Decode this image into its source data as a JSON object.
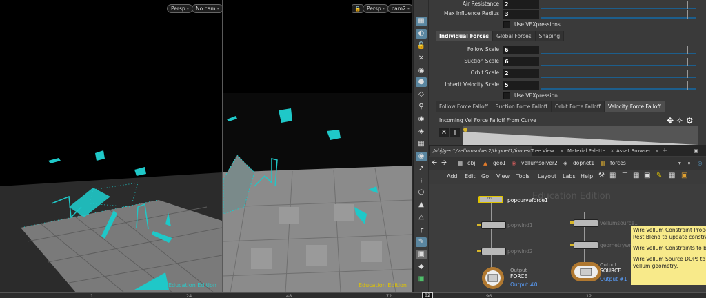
{
  "viewports": {
    "left": {
      "persp": "Persp -",
      "cam": "No cam -",
      "edu": "Education Edition"
    },
    "right": {
      "persp": "Persp -",
      "cam": "cam2 -",
      "edu": "Education Edition"
    }
  },
  "params": {
    "air_resistance": {
      "label": "Air Resistance",
      "value": "2"
    },
    "max_influence_radius": {
      "label": "Max Influence Radius",
      "value": "3"
    },
    "use_vex_1": "Use VEXpressions",
    "tabs": [
      "Individual Forces",
      "Global Forces",
      "Shaping"
    ],
    "follow_scale": {
      "label": "Follow Scale",
      "value": "6"
    },
    "suction_scale": {
      "label": "Suction Scale",
      "value": "6"
    },
    "orbit_scale": {
      "label": "Orbit Scale",
      "value": "2"
    },
    "inherit_velocity_scale": {
      "label": "Inherit Velocity Scale",
      "value": "5"
    },
    "use_vex_2": "Use VEXpression",
    "falloff_tabs": [
      "Follow Force Falloff",
      "Suction Force Falloff",
      "Orbit Force Falloff",
      "Velocity Force Falloff"
    ],
    "incoming_label": "Incoming Vel Force Falloff From Curve"
  },
  "network": {
    "tabs": [
      "/obj/geo1/vellumsolver2/dopnet1/forces",
      "Tree View",
      "Material Palette",
      "Asset Browser"
    ],
    "path": [
      "obj",
      "geo1",
      "vellumsolver2",
      "dopnet1",
      "forces"
    ],
    "menu": [
      "Add",
      "Edit",
      "Go",
      "View",
      "Tools",
      "Layout",
      "Labs",
      "Help"
    ],
    "watermark": "Education Edition",
    "nodes": {
      "popcurveforce1": "popcurveforce1",
      "popwind1": "popwind1",
      "popwind2": "popwind2",
      "force_output": "Output",
      "force_name": "FORCE",
      "force_port": "Output #0",
      "vellumsource1": "vellumsource1",
      "geometrywrangle1": "geometrywrangle1",
      "source_output": "Output",
      "source_name": "SOURCE",
      "source_port": "Output #1"
    },
    "tooltip": [
      "Wire Vellum Constraint Prope",
      "Rest Blend to update constrai",
      "Wire Vellum Constraints to bu",
      "Wire Vellum Source DOPs to S",
      "vellum geometry."
    ]
  },
  "timeline": {
    "ticks": [
      "1",
      "24",
      "48",
      "72",
      "96",
      "12"
    ],
    "current_frame": "82"
  }
}
